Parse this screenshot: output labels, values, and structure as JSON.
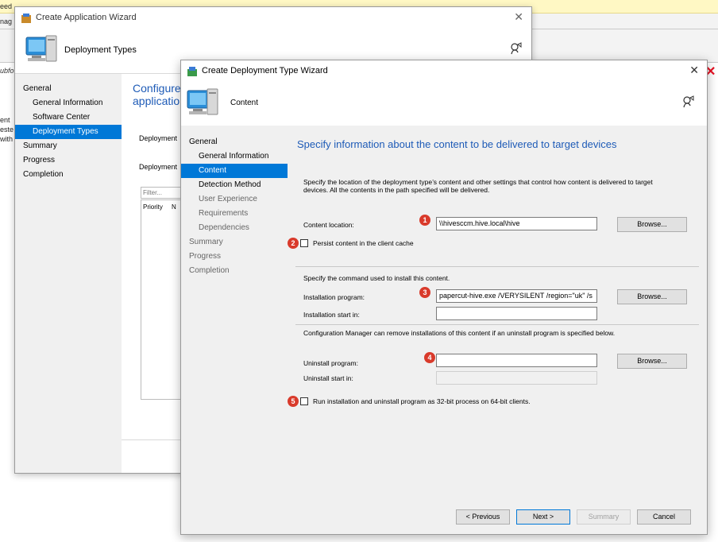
{
  "background": {
    "fragments": [
      "eed",
      "nag",
      "ubfo",
      "ent",
      "este",
      "with"
    ]
  },
  "back_wizard": {
    "title": "Create Application Wizard",
    "page_name": "Deployment Types",
    "nav": {
      "general": "General",
      "general_information": "General Information",
      "software_center": "Software Center",
      "deployment_types": "Deployment Types",
      "summary": "Summary",
      "progress": "Progress",
      "completion": "Completion"
    },
    "heading_line1": "Configure",
    "heading_line2": "application",
    "label_deployment_1": "Deployment",
    "label_deployment_2": "Deployment",
    "filter_placeholder": "Filter...",
    "column_priority": "Priority",
    "column_n": "N"
  },
  "front_wizard": {
    "title": "Create Deployment Type Wizard",
    "page_name": "Content",
    "nav": {
      "general": "General",
      "general_information": "General Information",
      "content": "Content",
      "detection_method": "Detection Method",
      "user_experience": "User Experience",
      "requirements": "Requirements",
      "dependencies": "Dependencies",
      "summary": "Summary",
      "progress": "Progress",
      "completion": "Completion"
    },
    "heading": "Specify information about the content to be delivered to target devices",
    "description_line1": "Specify the location of the deployment type’s content and other settings that control how content is delivered to target",
    "description_line2": "devices. All the contents in the path specified will be delivered.",
    "content_location_label": "Content location:",
    "content_location_value": "\\\\hivesccm.hive.local\\hive",
    "browse_label": "Browse...",
    "persist_label": "Persist content in the client cache",
    "command_section_label": "Specify the command used to install this content.",
    "installation_program_label": "Installation program:",
    "installation_program_value": "papercut-hive.exe /VERYSILENT /region=\"uk\" /s",
    "installation_start_label": "Installation start in:",
    "installation_start_value": "",
    "uninstall_note": "Configuration Manager can remove installations of this content if an uninstall program is specified below.",
    "uninstall_program_label": "Uninstall program:",
    "uninstall_program_value": "",
    "uninstall_start_label": "Uninstall start in:",
    "uninstall_start_value": "",
    "run_32bit_label": "Run installation and uninstall program as 32-bit process on 64-bit clients.",
    "buttons": {
      "previous": "< Previous",
      "next": "Next >",
      "summary": "Summary",
      "cancel": "Cancel"
    }
  },
  "badges": [
    "1",
    "2",
    "3",
    "4",
    "5"
  ],
  "colors": {
    "accent": "#0078d7",
    "heading": "#1e5bb7",
    "badge": "#d93a2b",
    "banner": "#fff8c4"
  }
}
